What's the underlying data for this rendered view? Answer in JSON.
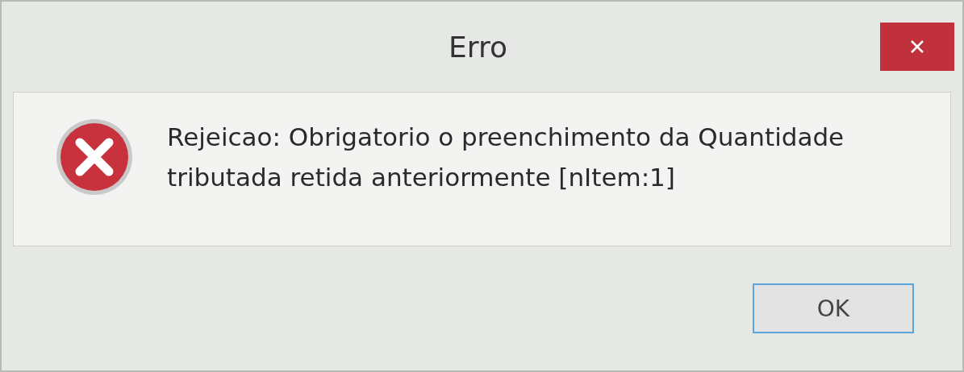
{
  "window": {
    "title": "Erro"
  },
  "message": {
    "kind": "error",
    "lines": [
      "Rejeicao: Obrigatorio o preenchimento da Quantidade",
      "tributada retida anteriormente [nItem:1]"
    ]
  },
  "buttons": [
    {
      "label": "OK",
      "selected": true
    }
  ]
}
